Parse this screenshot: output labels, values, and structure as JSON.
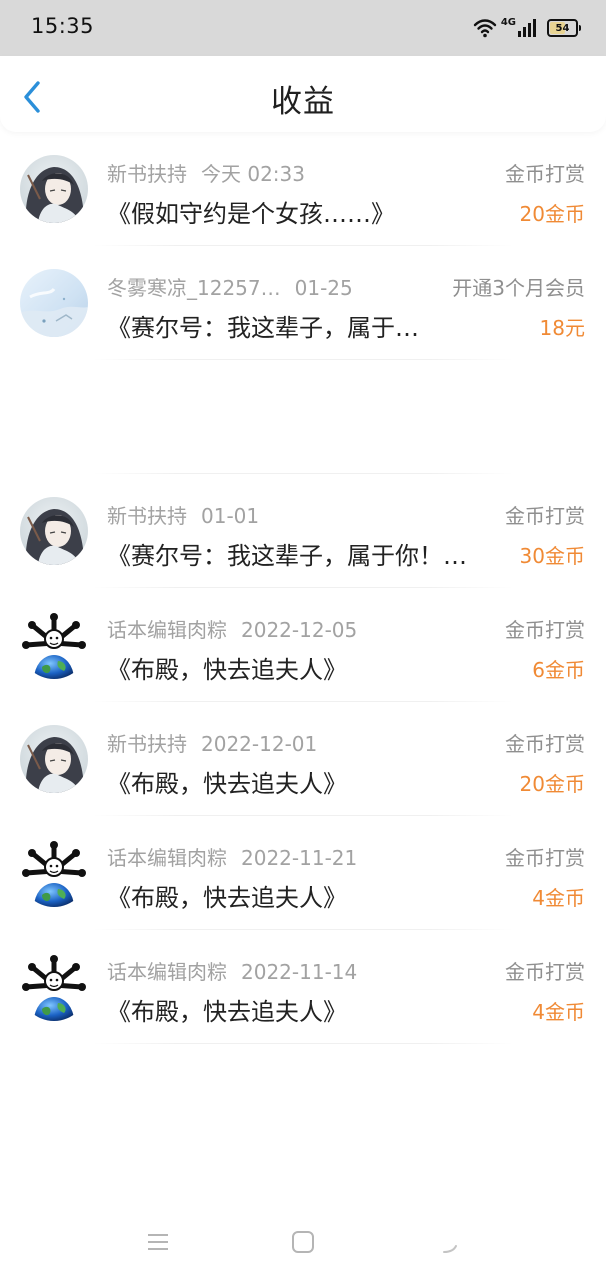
{
  "status_bar": {
    "time": "15:35",
    "network": "4G",
    "battery_level": "54",
    "battery_fraction": 0.54,
    "icons": [
      "wifi-icon",
      "signal-icon",
      "battery-icon"
    ]
  },
  "header": {
    "title": "收益",
    "back_icon": "chevron-left-icon"
  },
  "colors": {
    "accent": "#2b8fd9",
    "amount": "#f08a35",
    "meta": "#a2a2a2",
    "primary_text": "#222222"
  },
  "records": [
    {
      "source": "新书扶持",
      "date": "今天 02:33",
      "type": "金币打赏",
      "book": "《假如守约是个女孩……》",
      "amount": "20金币",
      "avatar": "avatar-anime-portrait"
    },
    {
      "source": "冬雾寒凉_12257…",
      "date": "01-25",
      "type": "开通3个月会员",
      "book": "《赛尔号：我这辈子，属于…",
      "amount": "18元",
      "avatar": "avatar-sky-scene"
    },
    {
      "source": "新书扶持",
      "date": "01-01",
      "type": "金币打赏",
      "book": "《赛尔号：我这辈子，属于你！…",
      "amount": "30金币",
      "avatar": "avatar-anime-portrait"
    },
    {
      "source": "话本编辑肉粽",
      "date": "2022-12-05",
      "type": "金币打赏",
      "book": "《布殿，快去追夫人》",
      "amount": "6金币",
      "avatar": "avatar-globe-meme"
    },
    {
      "source": "新书扶持",
      "date": "2022-12-01",
      "type": "金币打赏",
      "book": "《布殿，快去追夫人》",
      "amount": "20金币",
      "avatar": "avatar-anime-portrait"
    },
    {
      "source": "话本编辑肉粽",
      "date": "2022-11-21",
      "type": "金币打赏",
      "book": "《布殿，快去追夫人》",
      "amount": "4金币",
      "avatar": "avatar-globe-meme"
    },
    {
      "source": "话本编辑肉粽",
      "date": "2022-11-14",
      "type": "金币打赏",
      "book": "《布殿，快去追夫人》",
      "amount": "4金币",
      "avatar": "avatar-globe-meme"
    }
  ],
  "nav_bar": {
    "buttons": [
      "menu-icon",
      "home-icon",
      "back-icon"
    ]
  }
}
